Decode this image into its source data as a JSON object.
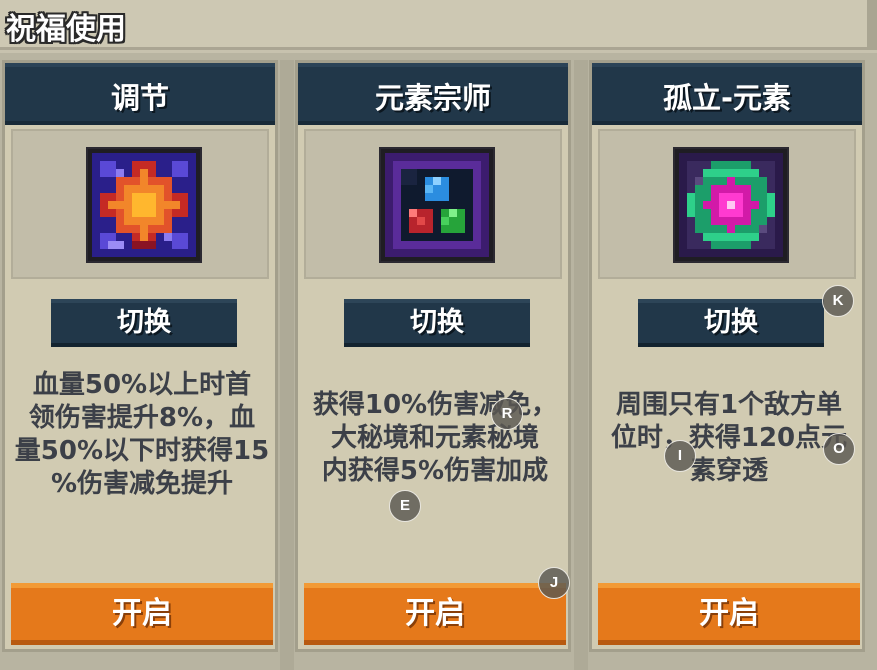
{
  "header": {
    "title": "祝福使用"
  },
  "cards": [
    {
      "title": "调节",
      "icon": "fire-burst-icon",
      "switch_label": "切换",
      "desc_lines": [
        "血量50%以上时首",
        "领伤害提升8%，血",
        "量50%以下时获得15",
        "%伤害减免提升"
      ],
      "open_label": "开启"
    },
    {
      "title": "元素宗师",
      "icon": "element-gems-icon",
      "switch_label": "切换",
      "desc_lines": [
        "获得10%伤害减免，",
        "大秘境和元素秘境",
        "内获得5%伤害加成"
      ],
      "open_label": "开启"
    },
    {
      "title": "孤立-元素",
      "icon": "isolated-element-icon",
      "switch_label": "切换",
      "desc_lines": [
        "周围只有1个敌方单",
        "位时，获得120点元",
        "素穿透"
      ],
      "open_label": "开启"
    }
  ],
  "markers": [
    "R",
    "E",
    "J",
    "K",
    "I",
    "O"
  ],
  "colors": {
    "header_navy": "#213749",
    "button_orange": "#e5791b",
    "card_bg": "#d1cbb2",
    "desc_text": "#3c4048"
  }
}
